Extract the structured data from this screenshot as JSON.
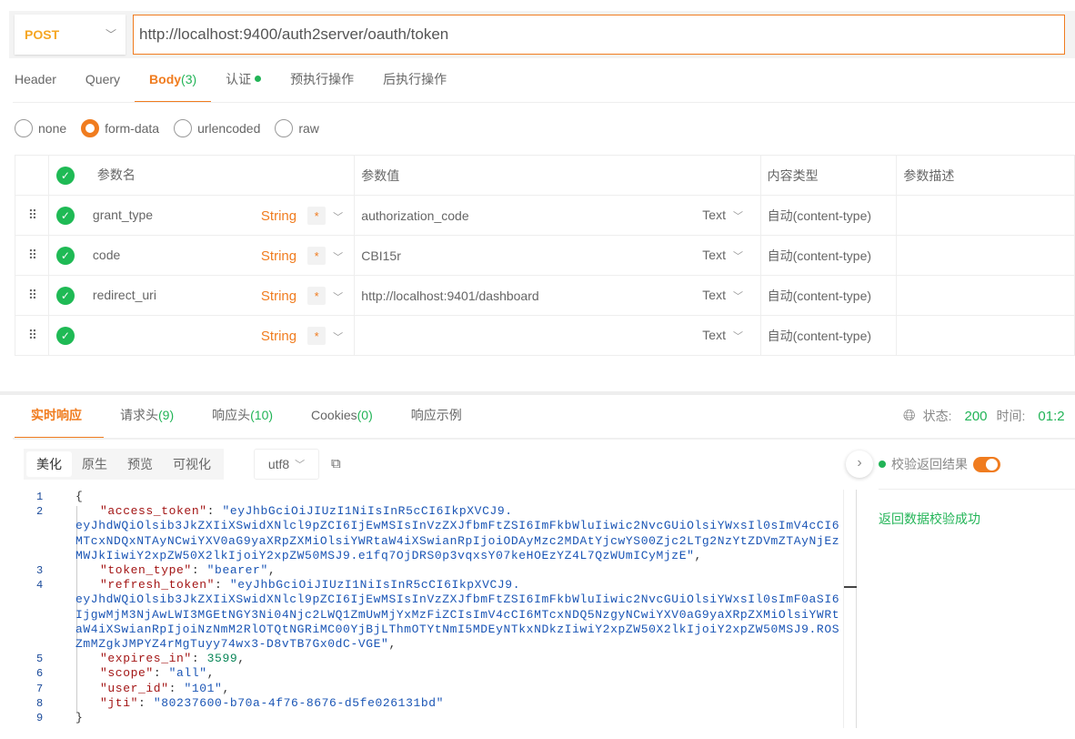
{
  "request": {
    "method": "POST",
    "url": "http://localhost:9400/auth2server/oauth/token",
    "tabs": [
      {
        "label": "Header"
      },
      {
        "label": "Query"
      },
      {
        "label": "Body",
        "count": "(3)"
      },
      {
        "label": "认证",
        "dot": true
      },
      {
        "label": "预执行操作"
      },
      {
        "label": "后执行操作"
      }
    ],
    "active_tab": "Body",
    "body_types": [
      "none",
      "form-data",
      "urlencoded",
      "raw"
    ],
    "selected_body_type": "form-data"
  },
  "params": {
    "headers": [
      "参数名",
      "参数值",
      "内容类型",
      "参数描述"
    ],
    "rows": [
      {
        "name": "grant_type",
        "type": "String",
        "required": "*",
        "value": "authorization_code",
        "value_type": "Text",
        "content_type": "自动(content-type)",
        "desc": ""
      },
      {
        "name": "code",
        "type": "String",
        "required": "*",
        "value": "CBI15r",
        "value_type": "Text",
        "content_type": "自动(content-type)",
        "desc": ""
      },
      {
        "name": "redirect_uri",
        "type": "String",
        "required": "*",
        "value": "http://localhost:9401/dashboard",
        "value_type": "Text",
        "content_type": "自动(content-type)",
        "desc": ""
      },
      {
        "name": "",
        "type": "String",
        "required": "*",
        "value": "",
        "value_type": "Text",
        "content_type": "自动(content-type)",
        "desc": ""
      }
    ]
  },
  "response": {
    "tabs": [
      {
        "label": "实时响应"
      },
      {
        "label": "请求头",
        "count": "(9)"
      },
      {
        "label": "响应头",
        "count": "(10)"
      },
      {
        "label": "Cookies",
        "count": "(0)"
      },
      {
        "label": "响应示例"
      }
    ],
    "status_label": "状态:",
    "status": "200",
    "time_label": "时间:",
    "time": "01:2",
    "view_modes": [
      "美化",
      "原生",
      "预览",
      "可视化"
    ],
    "active_view": "美化",
    "encoding": "utf8",
    "verify_label": "校验返回结果",
    "verify_enabled": true,
    "verify_result": "返回数据校验成功",
    "json": {
      "access_token": "eyJhbGciOiJIUzI1NiIsInR5cCI6IkpXVCJ9.eyJhdWQiOlsib3JkZXIiXSwidXNlcl9pZCI6IjEwMSIsInVzZXJfbmFtZSI6ImFkbWluIiwic2NvcGUiOlsiYWxsIl0sImV4cCI6MTcxNDQxNTAyNCwiYXV0aG9yaXRpZXMiOlsiYWRtaW4iXSwianRpIjoiODAyMzc2MDAtYjcwYS00Zjc2LTg2NzYtZDVmZTAyNjEzMWJkIiwiY2xpZW50X2lkIjoiY2xpZW50MSJ9.e1fq7OjDRS0p3vqxsY07keHOEzYZ4L7QzWUmICyMjzE",
      "token_type": "bearer",
      "refresh_token": "eyJhbGciOiJIUzI1NiIsInR5cCI6IkpXVCJ9.eyJhdWQiOlsib3JkZXIiXSwidXNlcl9pZCI6IjEwMSIsInVzZXJfbmFtZSI6ImFkbWluIiwic2NvcGUiOlsiYWxsIl0sImF0aSI6IjgwMjM3NjAwLWI3MGEtNGY3Ni04Njc2LWQ1ZmUwMjYxMzFiZCIsImV4cCI6MTcxNDQ5NzgyNCwiYXV0aG9yaXRpZXMiOlsiYWRtaW4iXSwianRpIjoiNzNmM2RlOTQtNGRiMC00YjBjLThmOTYtNmI5MDEyNTkxNDkzIiwiY2xpZW50X2lkIjoiY2xpZW50MSJ9.ROSZmMZgkJMPYZ4rMgTuyy74wx3-D8vTB7Gx0dC-VGE",
      "expires_in": 3599,
      "scope": "all",
      "user_id": "101",
      "jti": "80237600-b70a-4f76-8676-d5fe026131bd"
    }
  },
  "colors": {
    "accent": "#f07c1f",
    "success": "#22b457",
    "method": "#f5a623"
  }
}
